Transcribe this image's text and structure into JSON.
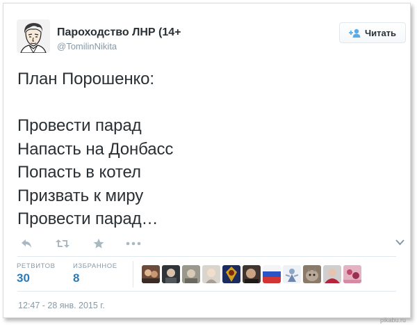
{
  "tweet": {
    "author_name": "Пароходство ЛНР (14+",
    "author_handle": "@TomilinNikita",
    "follow_label": "Читать",
    "text_lines": [
      "План Порошенко:",
      "",
      "Провести парад",
      "Напасть на Донбасс",
      "Попасть в котел",
      "Призвать к миру",
      "Провести парад…"
    ],
    "text": "План Порошенко:\n\nПровести парад\nНапасть на Донбасс\nПопасть в котел\nПризвать к миру\nПровести парад…"
  },
  "actions": {
    "icons": [
      "reply-icon",
      "retweet-icon",
      "favorite-icon",
      "more-icon"
    ],
    "more_glyph": "•••"
  },
  "stats": {
    "retweets_label": "РЕТВИТОВ",
    "retweets_value": "30",
    "favorites_label": "ИЗБРАННОЕ",
    "favorites_value": "8"
  },
  "timestamp": "12:47 - 28 янв. 2015 г.",
  "watermark": "pikabu.ru",
  "colors": {
    "text": "#292f33",
    "muted": "#8899a6",
    "accent": "#2b7bb9",
    "border": "#e1e8ed",
    "icon": "#aab8c2"
  }
}
